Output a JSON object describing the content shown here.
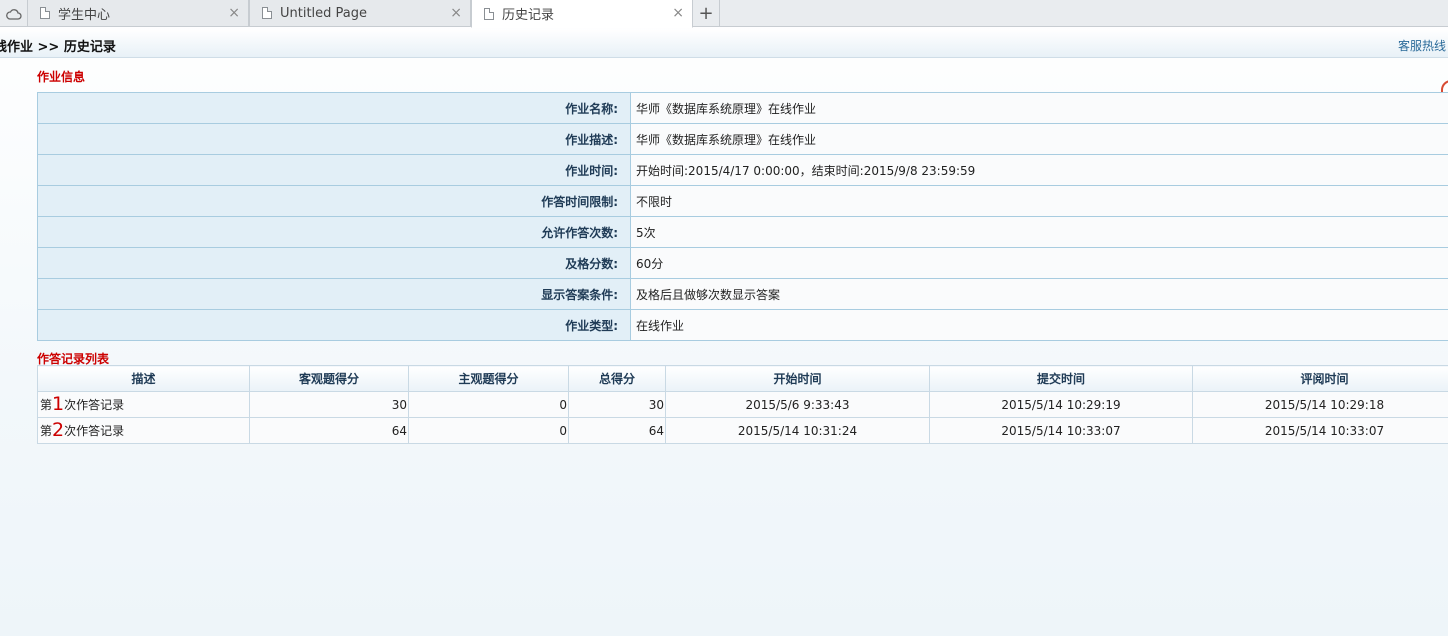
{
  "tabs": [
    {
      "label": "学生中心",
      "active": false
    },
    {
      "label": "Untitled Page",
      "active": false
    },
    {
      "label": "历史记录",
      "active": true
    }
  ],
  "tab_close_glyph": "×",
  "new_tab_glyph": "+",
  "breadcrumb": "线作业  >> 历史记录",
  "hotline": "客服热线",
  "info_section_title": "作业信息",
  "info_rows": [
    {
      "label": "作业名称:",
      "value": "华师《数据库系统原理》在线作业"
    },
    {
      "label": "作业描述:",
      "value": "华师《数据库系统原理》在线作业"
    },
    {
      "label": "作业时间:",
      "value": "开始时间:2015/4/17 0:00:00，结束时间:2015/9/8 23:59:59"
    },
    {
      "label": "作答时间限制:",
      "value": "不限时"
    },
    {
      "label": "允许作答次数:",
      "value": "5次"
    },
    {
      "label": "及格分数:",
      "value": "60分"
    },
    {
      "label": "显示答案条件:",
      "value": "及格后且做够次数显示答案"
    },
    {
      "label": "作业类型:",
      "value": "在线作业"
    }
  ],
  "records_section_title": "作答记录列表",
  "records": {
    "columns": [
      "描述",
      "客观题得分",
      "主观题得分",
      "总得分",
      "开始时间",
      "提交时间",
      "评阅时间"
    ],
    "rows": [
      {
        "prefix": "第",
        "index": "1",
        "suffix": "次作答记录",
        "objective": "30",
        "subjective": "0",
        "total": "30",
        "start": "2015/5/6 9:33:43",
        "submit": "2015/5/14 10:29:19",
        "review": "2015/5/14 10:29:18"
      },
      {
        "prefix": "第",
        "index": "2",
        "suffix": "次作答记录",
        "objective": "64",
        "subjective": "0",
        "total": "64",
        "start": "2015/5/14 10:31:24",
        "submit": "2015/5/14 10:33:07",
        "review": "2015/5/14 10:33:07"
      }
    ]
  },
  "icons": {
    "home": "cloud-icon",
    "tab": "page-icon",
    "close": "close-icon",
    "new_tab": "plus-icon"
  }
}
